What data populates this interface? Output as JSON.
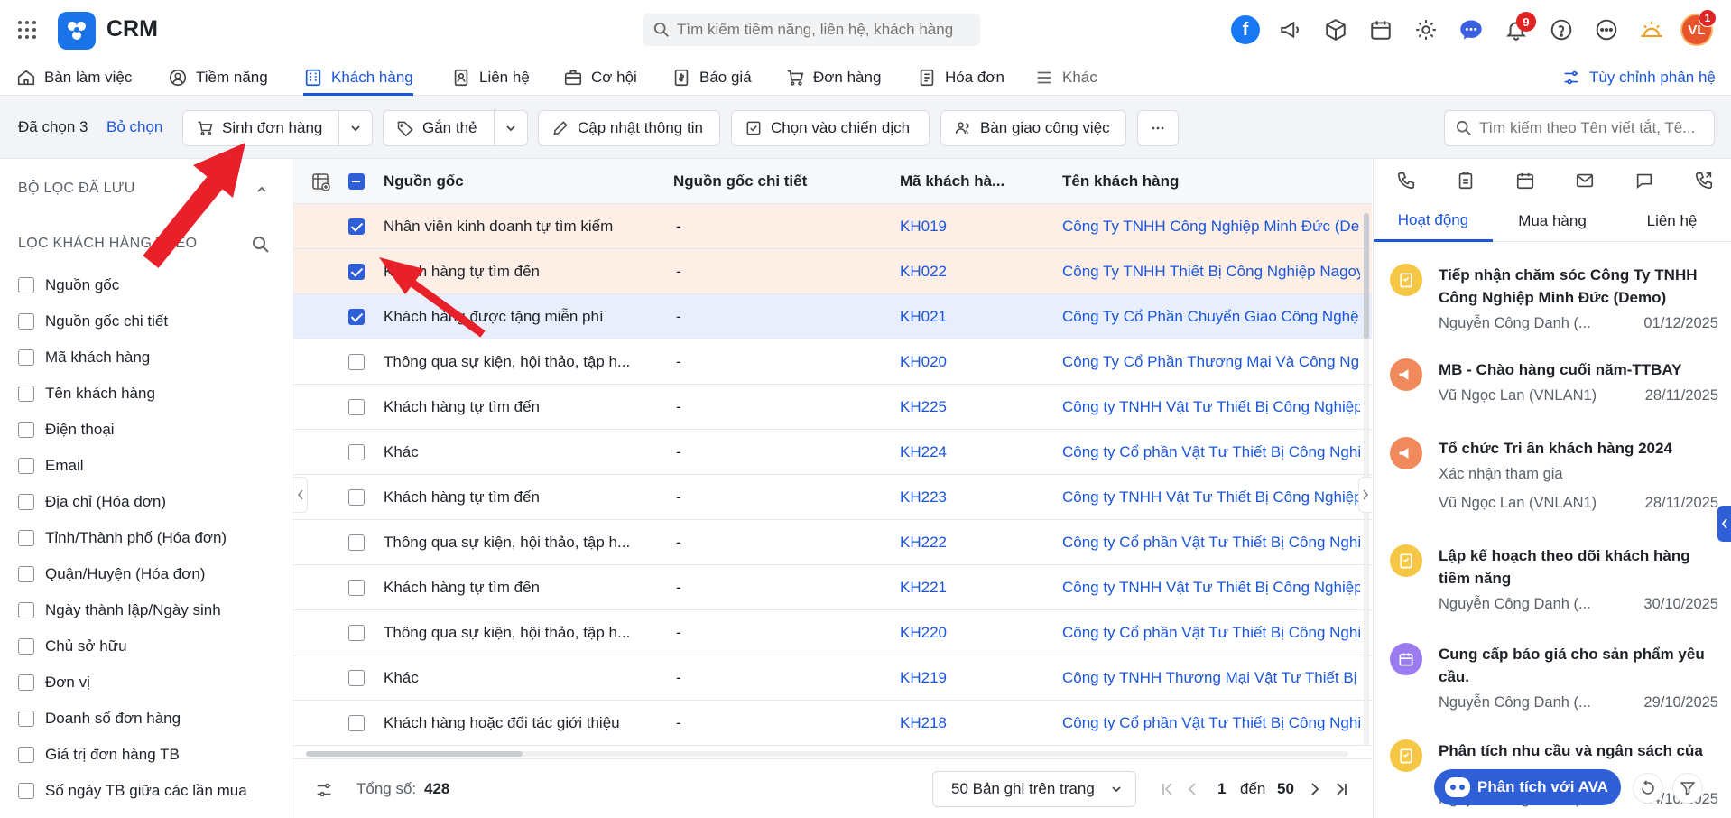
{
  "app": {
    "title": "CRM"
  },
  "search": {
    "placeholder": "Tìm kiếm tiềm năng, liên hệ, khách hàng"
  },
  "header": {
    "notif_count": "9",
    "avatar_initials": "VL",
    "avatar_badge": "1"
  },
  "nav": {
    "items": [
      "Bàn làm việc",
      "Tiềm năng",
      "Khách hàng",
      "Liên hệ",
      "Cơ hội",
      "Báo giá",
      "Đơn hàng",
      "Hóa đơn",
      "Khác"
    ],
    "customize": "Tùy chỉnh phân hệ"
  },
  "actions": {
    "selected_label": "Đã chọn 3",
    "deselect": "Bỏ chọn",
    "create_order": "Sinh đơn hàng",
    "tag": "Gắn thẻ",
    "update": "Cập nhật thông tin",
    "campaign": "Chọn vào chiến dịch",
    "handover": "Bàn giao công việc",
    "search_placeholder": "Tìm kiếm theo Tên viết tắt, Tê..."
  },
  "sidebar": {
    "saved_filters": "BỘ LỌC ĐÃ LƯU",
    "filter_by": "LỌC KHÁCH HÀNG THEO",
    "fields": [
      "Nguồn gốc",
      "Nguồn gốc chi tiết",
      "Mã khách hàng",
      "Tên khách hàng",
      "Điện thoại",
      "Email",
      "Địa chỉ (Hóa đơn)",
      "Tỉnh/Thành phố (Hóa đơn)",
      "Quận/Huyện (Hóa đơn)",
      "Ngày thành lập/Ngày sinh",
      "Chủ sở hữu",
      "Đơn vị",
      "Doanh số đơn hàng",
      "Giá trị đơn hàng TB",
      "Số ngày TB giữa các lần mua"
    ]
  },
  "table": {
    "columns": [
      "Nguồn gốc",
      "Nguồn gốc chi tiết",
      "Mã khách hà...",
      "Tên khách hàng"
    ],
    "rows": [
      {
        "source": "Nhân viên kinh doanh tự tìm kiếm",
        "detail": "-",
        "code": "KH019",
        "name": "Công Ty TNHH Công Nghiệp Minh Đức (Demo)",
        "checked": true
      },
      {
        "source": "Khách hàng tự tìm đến",
        "detail": "-",
        "code": "KH022",
        "name": "Công Ty TNHH Thiết Bị Công Nghiệp Nagoya",
        "checked": true
      },
      {
        "source": "Khách hàng được tặng miễn phí",
        "detail": "-",
        "code": "KH021",
        "name": "Công Ty Cổ Phần Chuyển Giao Công Nghệ",
        "checked": true
      },
      {
        "source": "Thông qua sự kiện, hội thảo, tập h...",
        "detail": "-",
        "code": "KH020",
        "name": "Công Ty Cổ Phần Thương Mại Và Công Nghệ",
        "checked": false
      },
      {
        "source": "Khách hàng tự tìm đến",
        "detail": "-",
        "code": "KH225",
        "name": "Công ty TNHH Vật Tư Thiết Bị Công Nghiệp",
        "checked": false
      },
      {
        "source": "Khác",
        "detail": "-",
        "code": "KH224",
        "name": "Công ty Cổ phần Vật Tư Thiết Bị Công Nghiệp",
        "checked": false
      },
      {
        "source": "Khách hàng tự tìm đến",
        "detail": "-",
        "code": "KH223",
        "name": "Công ty TNHH Vật Tư Thiết Bị Công Nghiệp",
        "checked": false
      },
      {
        "source": "Thông qua sự kiện, hội thảo, tập h...",
        "detail": "-",
        "code": "KH222",
        "name": "Công ty Cổ phần Vật Tư Thiết Bị Công Nghiệp",
        "checked": false
      },
      {
        "source": "Khách hàng tự tìm đến",
        "detail": "-",
        "code": "KH221",
        "name": "Công ty TNHH Vật Tư Thiết Bị Công Nghiệp",
        "checked": false
      },
      {
        "source": "Thông qua sự kiện, hội thảo, tập h...",
        "detail": "-",
        "code": "KH220",
        "name": "Công ty Cổ phần Vật Tư Thiết Bị Công Nghiệp",
        "checked": false
      },
      {
        "source": "Khác",
        "detail": "-",
        "code": "KH219",
        "name": "Công ty TNHH Thương Mại Vật Tư Thiết Bị Công",
        "checked": false
      },
      {
        "source": "Khách hàng hoặc đối tác giới thiệu",
        "detail": "-",
        "code": "KH218",
        "name": "Công ty Cổ phần Vật Tư Thiết Bị Công Nghiệp",
        "checked": false
      }
    ]
  },
  "footer": {
    "total_label": "Tổng số:",
    "total": "428",
    "page_size": "50 Bản ghi trên trang",
    "page_from": "1",
    "to_label": "đến",
    "page_to": "50"
  },
  "panel": {
    "tabs": [
      "Hoạt động",
      "Mua hàng",
      "Liên hệ"
    ],
    "activities": [
      {
        "title": "Tiếp nhận chăm sóc Công Ty TNHH Công Nghiệp Minh Đức (Demo)",
        "sub": "",
        "person": "Nguyễn Công Danh (...",
        "date": "01/12/2025",
        "type": "task"
      },
      {
        "title": "MB - Chào hàng cuối năm-TTBAY",
        "sub": "",
        "person": "Vũ Ngọc Lan (VNLAN1)",
        "date": "28/11/2025",
        "type": "campaign"
      },
      {
        "title": "Tổ chức Tri ân khách hàng 2024",
        "sub": "Xác nhận tham gia",
        "person": "Vũ Ngọc Lan (VNLAN1)",
        "date": "28/11/2025",
        "type": "campaign"
      },
      {
        "title": "Lập kế hoạch theo dõi khách hàng tiềm năng",
        "sub": "",
        "person": "Nguyễn Công Danh (...",
        "date": "30/10/2025",
        "type": "task"
      },
      {
        "title": "Cung cấp báo giá cho sản phẩm yêu cầu.",
        "sub": "",
        "person": "Nguyễn Công Danh (...",
        "date": "29/10/2025",
        "type": "event"
      },
      {
        "title": "Phân tích nhu cầu và ngân sách của",
        "sub": "",
        "person": "Nguyễn Công Danh (...",
        "date": "24/10/2025",
        "type": "task"
      }
    ],
    "ava_button": "Phân tích với AVA"
  },
  "colors": {
    "accent": "#1a56db",
    "selected_row": "#fdeee6",
    "active_row": "#e8eefc",
    "annotation": "#e8202a"
  }
}
